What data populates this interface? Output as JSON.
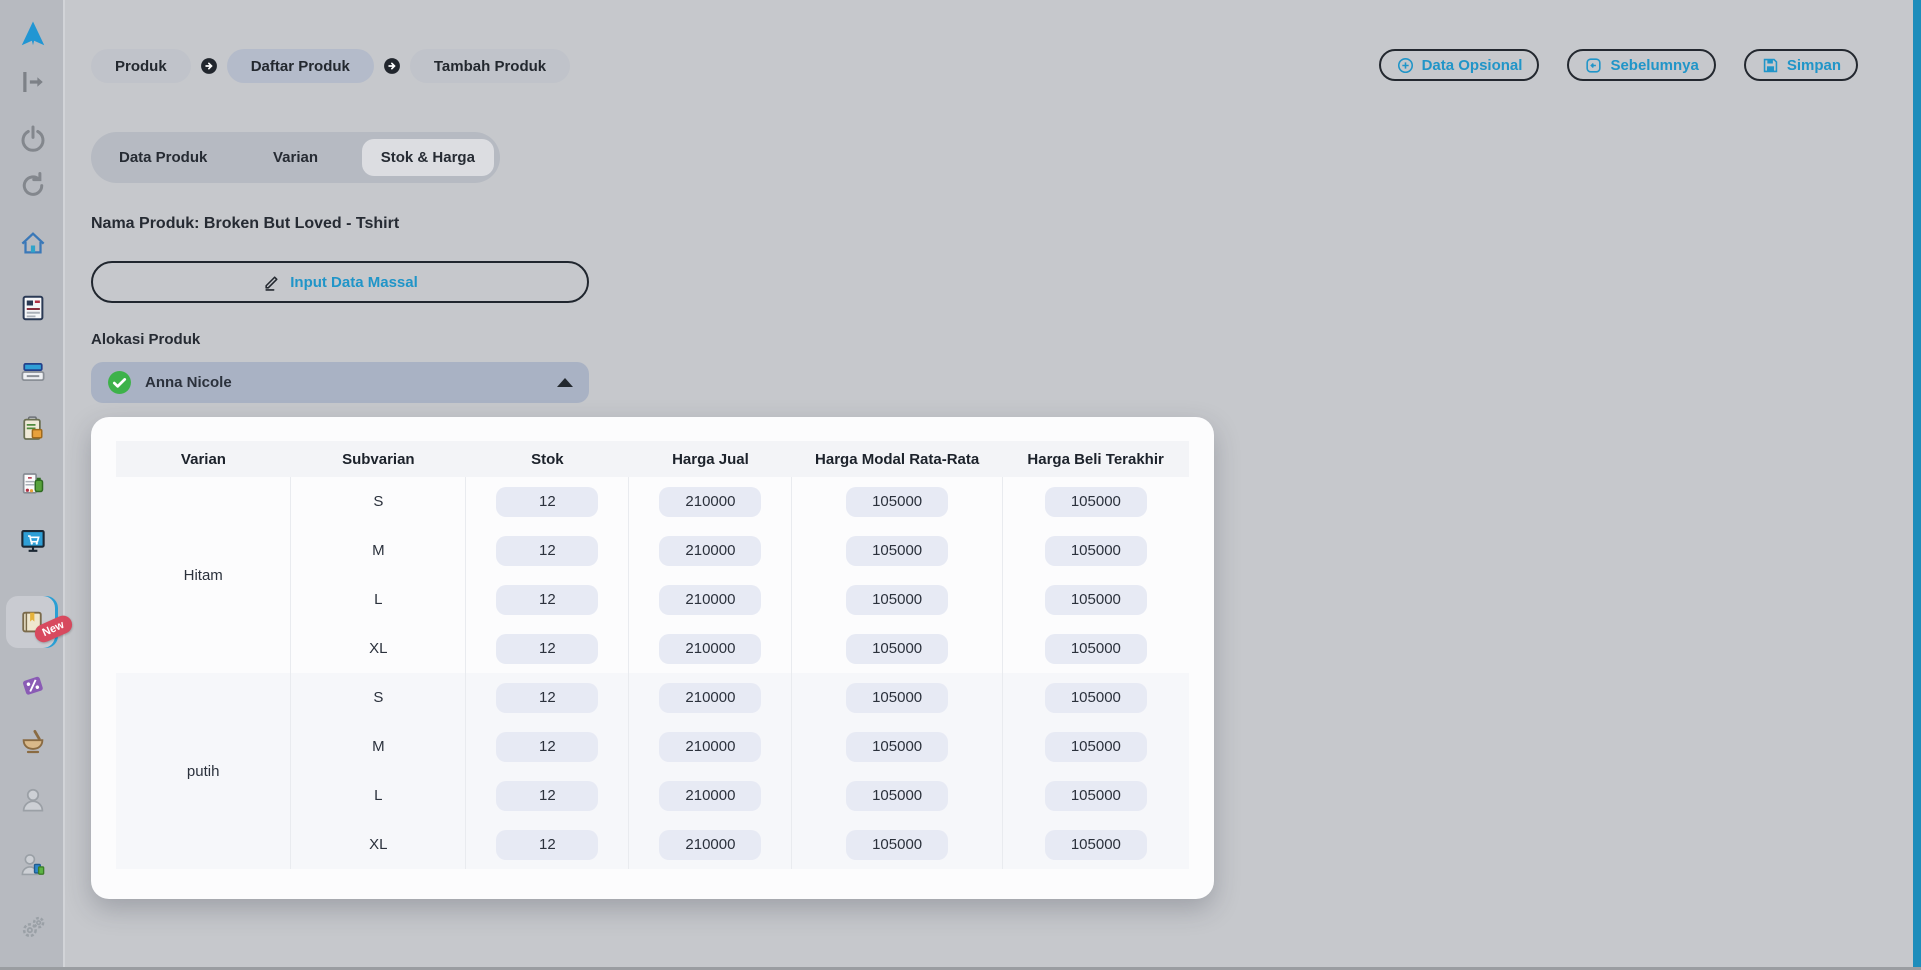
{
  "sidebar": {
    "new_badge": "New",
    "items": [
      {
        "icon": "brand-logo"
      },
      {
        "icon": "logout"
      },
      {
        "icon": "power"
      },
      {
        "icon": "refresh"
      },
      {
        "icon": "home"
      },
      {
        "icon": "news-document"
      },
      {
        "icon": "cash-register"
      },
      {
        "icon": "clipboard-order"
      },
      {
        "icon": "pharmacy-document"
      },
      {
        "icon": "online-store"
      },
      {
        "icon": "product-catalog"
      },
      {
        "icon": "discount-tag"
      },
      {
        "icon": "mortar-pestle"
      },
      {
        "icon": "customer"
      },
      {
        "icon": "supplier"
      },
      {
        "icon": "settings-gears"
      }
    ]
  },
  "breadcrumb": {
    "items": [
      "Produk",
      "Daftar Produk",
      "Tambah Produk"
    ]
  },
  "actions": {
    "data_opsional": "Data Opsional",
    "sebelumnya": "Sebelumnya",
    "simpan": "Simpan"
  },
  "tabs": {
    "items": [
      "Data Produk",
      "Varian",
      "Stok & Harga"
    ],
    "active": "Stok & Harga"
  },
  "product_name": "Nama Produk: Broken But Loved - Tshirt",
  "bulk_button_label": "Input Data Massal",
  "allocation": {
    "label": "Alokasi Produk",
    "selected": "Anna Nicole"
  },
  "table": {
    "columns": [
      "Varian",
      "Subvarian",
      "Stok",
      "Harga Jual",
      "Harga Modal Rata-Rata",
      "Harga Beli Terakhir"
    ],
    "groups": [
      {
        "varian": "Hitam",
        "rows": [
          {
            "sub": "S",
            "stok": "12",
            "harga_jual": "210000",
            "harga_modal": "105000",
            "harga_beli": "105000"
          },
          {
            "sub": "M",
            "stok": "12",
            "harga_jual": "210000",
            "harga_modal": "105000",
            "harga_beli": "105000"
          },
          {
            "sub": "L",
            "stok": "12",
            "harga_jual": "210000",
            "harga_modal": "105000",
            "harga_beli": "105000"
          },
          {
            "sub": "XL",
            "stok": "12",
            "harga_jual": "210000",
            "harga_modal": "105000",
            "harga_beli": "105000"
          }
        ]
      },
      {
        "varian": "putih",
        "rows": [
          {
            "sub": "S",
            "stok": "12",
            "harga_jual": "210000",
            "harga_modal": "105000",
            "harga_beli": "105000"
          },
          {
            "sub": "M",
            "stok": "12",
            "harga_jual": "210000",
            "harga_modal": "105000",
            "harga_beli": "105000"
          },
          {
            "sub": "L",
            "stok": "12",
            "harga_jual": "210000",
            "harga_modal": "105000",
            "harga_beli": "105000"
          },
          {
            "sub": "XL",
            "stok": "12",
            "harga_jual": "210000",
            "harga_modal": "105000",
            "harga_beli": "105000"
          }
        ]
      }
    ]
  },
  "colors": {
    "accent_teal": "#2095c8",
    "badge_red": "#d84a5f",
    "check_green": "#3db24a",
    "scrollbar_blue": "#1d8dbb",
    "dropdown_bg": "#a9b2c4"
  }
}
